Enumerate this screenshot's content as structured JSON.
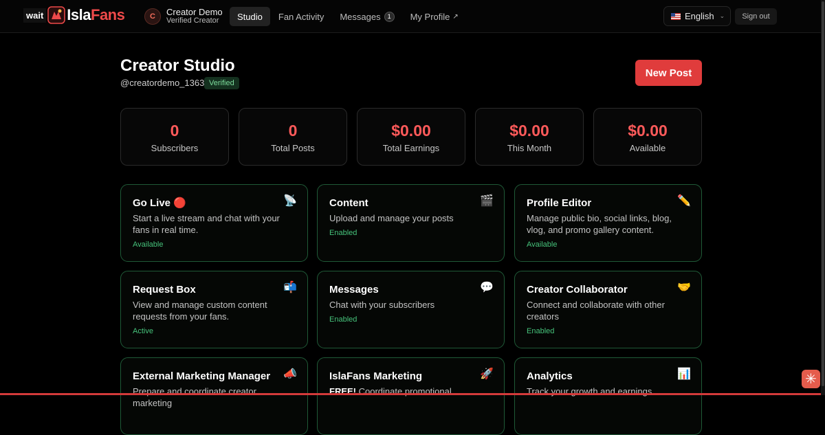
{
  "brand": {
    "prefix": "wait",
    "name_part1": "Isla",
    "name_part2": "Fans"
  },
  "user": {
    "initial": "C",
    "name": "Creator Demo",
    "role": "Verified Creator"
  },
  "nav": {
    "studio": "Studio",
    "fan_activity": "Fan Activity",
    "messages": "Messages",
    "messages_count": "1",
    "my_profile": "My Profile",
    "external_glyph": "↗"
  },
  "language": {
    "selected": "English"
  },
  "signout": "Sign out",
  "header": {
    "title": "Creator Studio",
    "handle": "@creatordemo_1363",
    "verified_badge": "Verified",
    "new_post": "New Post"
  },
  "stats": [
    {
      "value": "0",
      "label": "Subscribers"
    },
    {
      "value": "0",
      "label": "Total Posts"
    },
    {
      "value": "$0.00",
      "label": "Total Earnings"
    },
    {
      "value": "$0.00",
      "label": "This Month"
    },
    {
      "value": "$0.00",
      "label": "Available"
    }
  ],
  "cards": [
    {
      "title": "Go Live 🔴",
      "desc": "Start a live stream and chat with your fans in real time.",
      "status": "Available",
      "icon": "📡",
      "icon_name": "satellite-icon"
    },
    {
      "title": "Content",
      "desc": "Upload and manage your posts",
      "status": "Enabled",
      "icon": "🎬",
      "icon_name": "clapper-icon"
    },
    {
      "title": "Profile Editor",
      "desc": "Manage public bio, social links, blog, vlog, and promo gallery content.",
      "status": "Available",
      "icon": "✏️",
      "icon_name": "pencil-icon"
    },
    {
      "title": "Request Box",
      "desc": "View and manage custom content requests from your fans.",
      "status": "Active",
      "icon": "📬",
      "icon_name": "mailbox-icon"
    },
    {
      "title": "Messages",
      "desc": "Chat with your subscribers",
      "status": "Enabled",
      "icon": "💬",
      "icon_name": "speech-bubble-icon"
    },
    {
      "title": "Creator Collaborator",
      "desc": "Connect and collaborate with other creators",
      "status": "Enabled",
      "icon": "🤝",
      "icon_name": "handshake-icon"
    },
    {
      "title": "External Marketing Manager",
      "desc": "Prepare and coordinate creator marketing",
      "status": "",
      "icon": "📣",
      "icon_name": "megaphone-icon"
    },
    {
      "title": "IslaFans Marketing",
      "desc_strong": "FREE!",
      "desc": "Coordinate promotional",
      "status": "",
      "icon": "🚀",
      "icon_name": "rocket-icon"
    },
    {
      "title": "Analytics",
      "desc": "Track your growth and earnings",
      "status": "",
      "icon": "📊",
      "icon_name": "chart-icon"
    }
  ],
  "corner_button_glyph": "✳"
}
